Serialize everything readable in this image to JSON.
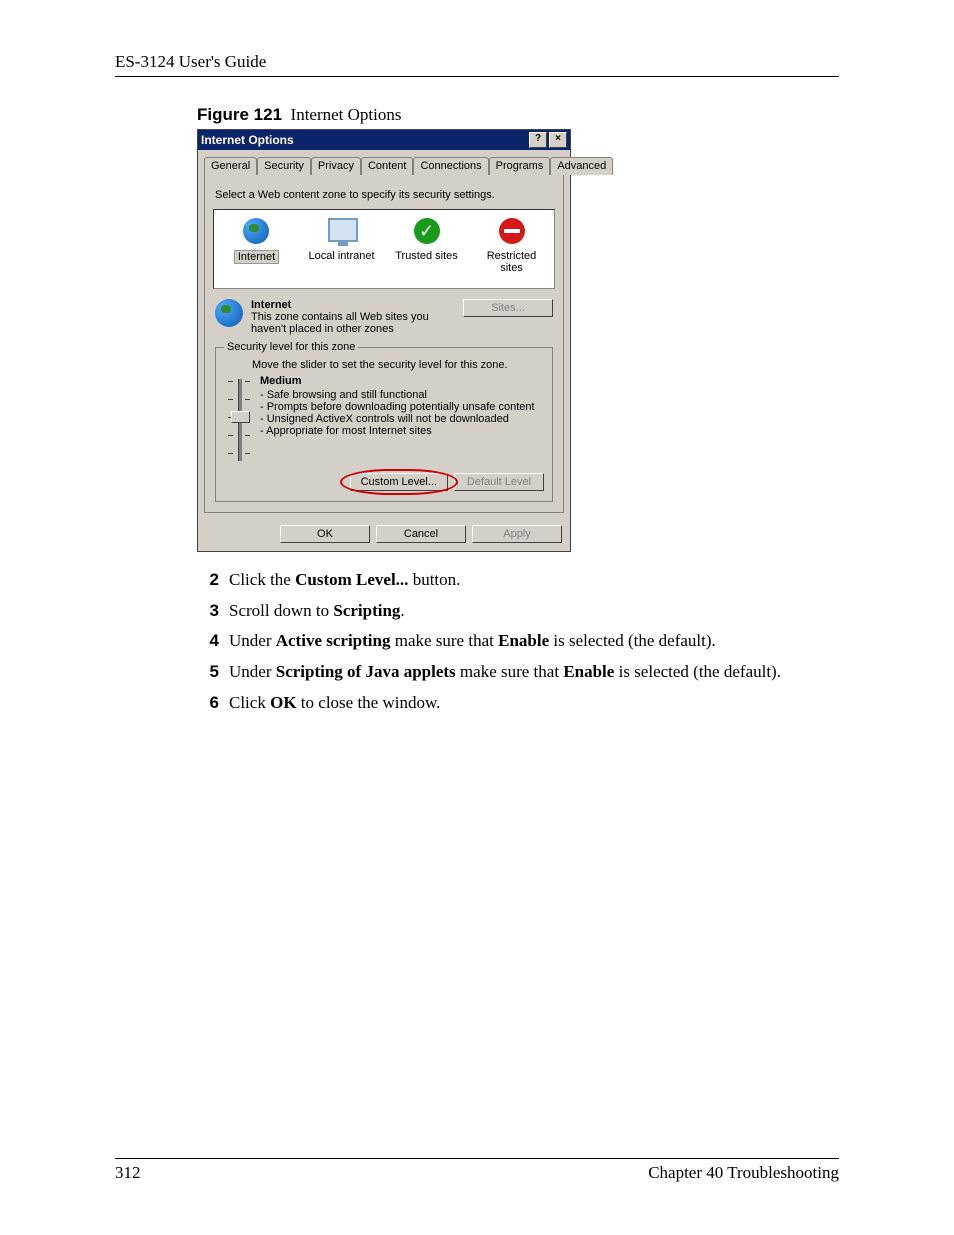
{
  "header": {
    "guide_title": "ES-3124 User's Guide"
  },
  "figure": {
    "label": "Figure 121",
    "caption": "Internet Options"
  },
  "dialog": {
    "title": "Internet Options",
    "help_btn": "?",
    "close_btn": "×",
    "tabs": {
      "general": "General",
      "security": "Security",
      "privacy": "Privacy",
      "content": "Content",
      "connections": "Connections",
      "programs": "Programs",
      "advanced": "Advanced"
    },
    "instruction": "Select a Web content zone to specify its security settings.",
    "zones": {
      "internet": "Internet",
      "local_intranet": "Local intranet",
      "trusted": "Trusted sites",
      "restricted": "Restricted sites"
    },
    "zone_info": {
      "title": "Internet",
      "desc": "This zone contains all Web sites you haven't placed in other zones",
      "sites_btn": "Sites..."
    },
    "security": {
      "legend": "Security level for this zone",
      "move_slider": "Move the slider to set the security level for this zone.",
      "level_name": "Medium",
      "bullets": {
        "b1": "- Safe browsing and still functional",
        "b2": "- Prompts before downloading potentially unsafe content",
        "b3": "- Unsigned ActiveX controls will not be downloaded",
        "b4": "- Appropriate for most Internet sites"
      },
      "custom_btn": "Custom Level...",
      "default_btn": "Default Level"
    },
    "buttons": {
      "ok": "OK",
      "cancel": "Cancel",
      "apply": "Apply"
    }
  },
  "steps": {
    "s2": {
      "n": "2",
      "pre": "Click the ",
      "bold1": "Custom Level...",
      "post": " button."
    },
    "s3": {
      "n": "3",
      "pre": "Scroll down to ",
      "bold1": "Scripting",
      "post": "."
    },
    "s4": {
      "n": "4",
      "pre": "Under ",
      "bold1": "Active scripting",
      "mid": " make sure that ",
      "bold2": "Enable",
      "post": " is selected (the default)."
    },
    "s5": {
      "n": "5",
      "pre": "Under ",
      "bold1": "Scripting of Java applets",
      "mid": " make sure that ",
      "bold2": "Enable",
      "post": " is selected (the default)."
    },
    "s6": {
      "n": "6",
      "pre": "Click ",
      "bold1": "OK",
      "post": " to close the window."
    }
  },
  "footer": {
    "page": "312",
    "chapter": "Chapter 40 Troubleshooting"
  }
}
